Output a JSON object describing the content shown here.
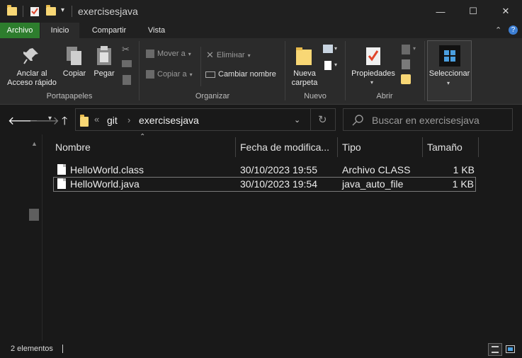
{
  "window": {
    "title": "exercisesjava",
    "controls": {
      "minimize": "—",
      "maximize": "☐",
      "close": "✕"
    }
  },
  "ribbon_tabs": [
    "Archivo",
    "Inicio",
    "Compartir",
    "Vista"
  ],
  "ribbon": {
    "portapapeles": {
      "label": "Portapapeles",
      "pin_line1": "Anclar al",
      "pin_line2": "Acceso rápido",
      "copy": "Copiar",
      "paste": "Pegar"
    },
    "organizar": {
      "label": "Organizar",
      "move_to": "Mover a",
      "copy_to": "Copiar a",
      "delete": "Elimінar",
      "rename": "Cambiar nombre"
    },
    "nuevo": {
      "label": "Nuevo",
      "new_folder_line1": "Nueva",
      "new_folder_line2": "carpeta"
    },
    "abrir": {
      "label": "Abrir",
      "properties": "Propiedades"
    },
    "seleccionar": {
      "label": "Seleccionar"
    }
  },
  "address": {
    "breadcrumb": [
      "git",
      "exercisesjava"
    ],
    "search_placeholder": "Buscar en exercisesjava"
  },
  "columns": [
    "Nombre",
    "Fecha de modifica...",
    "Tipo",
    "Tamaño"
  ],
  "files": [
    {
      "name": "HelloWorld.class",
      "modified": "30/10/2023 19:55",
      "type": "Archivo CLASS",
      "size": "1 KB"
    },
    {
      "name": "HelloWorld.java",
      "modified": "30/10/2023 19:54",
      "type": "java_auto_file",
      "size": "1 KB"
    }
  ],
  "status": {
    "items_count": "2 elementos"
  },
  "colors": {
    "file_tab": "#2d7d2d",
    "folder": "#f8d775",
    "background": "#191919"
  }
}
